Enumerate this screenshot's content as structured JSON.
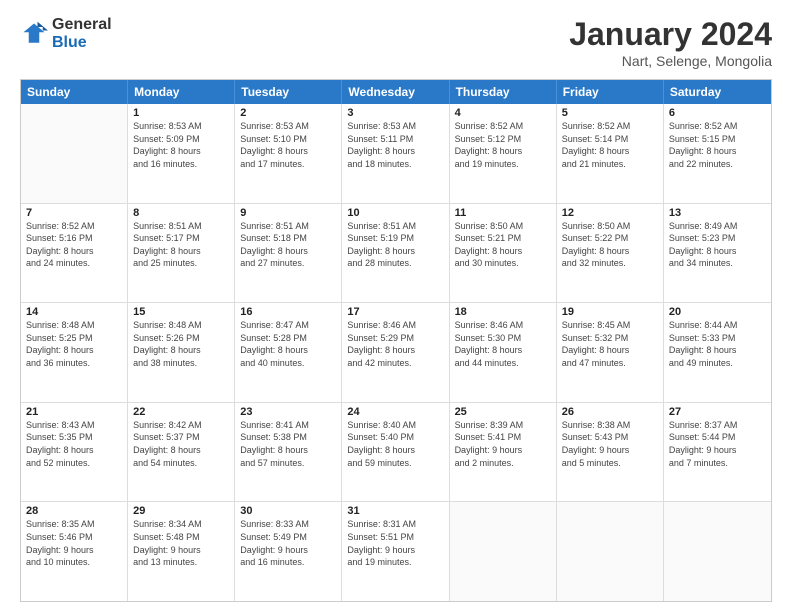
{
  "logo": {
    "general": "General",
    "blue": "Blue"
  },
  "title": "January 2024",
  "subtitle": "Nart, Selenge, Mongolia",
  "header_days": [
    "Sunday",
    "Monday",
    "Tuesday",
    "Wednesday",
    "Thursday",
    "Friday",
    "Saturday"
  ],
  "weeks": [
    [
      {
        "day": "",
        "sunrise": "",
        "sunset": "",
        "daylight": ""
      },
      {
        "day": "1",
        "sunrise": "Sunrise: 8:53 AM",
        "sunset": "Sunset: 5:09 PM",
        "daylight": "Daylight: 8 hours and 16 minutes."
      },
      {
        "day": "2",
        "sunrise": "Sunrise: 8:53 AM",
        "sunset": "Sunset: 5:10 PM",
        "daylight": "Daylight: 8 hours and 17 minutes."
      },
      {
        "day": "3",
        "sunrise": "Sunrise: 8:53 AM",
        "sunset": "Sunset: 5:11 PM",
        "daylight": "Daylight: 8 hours and 18 minutes."
      },
      {
        "day": "4",
        "sunrise": "Sunrise: 8:52 AM",
        "sunset": "Sunset: 5:12 PM",
        "daylight": "Daylight: 8 hours and 19 minutes."
      },
      {
        "day": "5",
        "sunrise": "Sunrise: 8:52 AM",
        "sunset": "Sunset: 5:14 PM",
        "daylight": "Daylight: 8 hours and 21 minutes."
      },
      {
        "day": "6",
        "sunrise": "Sunrise: 8:52 AM",
        "sunset": "Sunset: 5:15 PM",
        "daylight": "Daylight: 8 hours and 22 minutes."
      }
    ],
    [
      {
        "day": "7",
        "sunrise": "Sunrise: 8:52 AM",
        "sunset": "Sunset: 5:16 PM",
        "daylight": "Daylight: 8 hours and 24 minutes."
      },
      {
        "day": "8",
        "sunrise": "Sunrise: 8:51 AM",
        "sunset": "Sunset: 5:17 PM",
        "daylight": "Daylight: 8 hours and 25 minutes."
      },
      {
        "day": "9",
        "sunrise": "Sunrise: 8:51 AM",
        "sunset": "Sunset: 5:18 PM",
        "daylight": "Daylight: 8 hours and 27 minutes."
      },
      {
        "day": "10",
        "sunrise": "Sunrise: 8:51 AM",
        "sunset": "Sunset: 5:19 PM",
        "daylight": "Daylight: 8 hours and 28 minutes."
      },
      {
        "day": "11",
        "sunrise": "Sunrise: 8:50 AM",
        "sunset": "Sunset: 5:21 PM",
        "daylight": "Daylight: 8 hours and 30 minutes."
      },
      {
        "day": "12",
        "sunrise": "Sunrise: 8:50 AM",
        "sunset": "Sunset: 5:22 PM",
        "daylight": "Daylight: 8 hours and 32 minutes."
      },
      {
        "day": "13",
        "sunrise": "Sunrise: 8:49 AM",
        "sunset": "Sunset: 5:23 PM",
        "daylight": "Daylight: 8 hours and 34 minutes."
      }
    ],
    [
      {
        "day": "14",
        "sunrise": "Sunrise: 8:48 AM",
        "sunset": "Sunset: 5:25 PM",
        "daylight": "Daylight: 8 hours and 36 minutes."
      },
      {
        "day": "15",
        "sunrise": "Sunrise: 8:48 AM",
        "sunset": "Sunset: 5:26 PM",
        "daylight": "Daylight: 8 hours and 38 minutes."
      },
      {
        "day": "16",
        "sunrise": "Sunrise: 8:47 AM",
        "sunset": "Sunset: 5:28 PM",
        "daylight": "Daylight: 8 hours and 40 minutes."
      },
      {
        "day": "17",
        "sunrise": "Sunrise: 8:46 AM",
        "sunset": "Sunset: 5:29 PM",
        "daylight": "Daylight: 8 hours and 42 minutes."
      },
      {
        "day": "18",
        "sunrise": "Sunrise: 8:46 AM",
        "sunset": "Sunset: 5:30 PM",
        "daylight": "Daylight: 8 hours and 44 minutes."
      },
      {
        "day": "19",
        "sunrise": "Sunrise: 8:45 AM",
        "sunset": "Sunset: 5:32 PM",
        "daylight": "Daylight: 8 hours and 47 minutes."
      },
      {
        "day": "20",
        "sunrise": "Sunrise: 8:44 AM",
        "sunset": "Sunset: 5:33 PM",
        "daylight": "Daylight: 8 hours and 49 minutes."
      }
    ],
    [
      {
        "day": "21",
        "sunrise": "Sunrise: 8:43 AM",
        "sunset": "Sunset: 5:35 PM",
        "daylight": "Daylight: 8 hours and 52 minutes."
      },
      {
        "day": "22",
        "sunrise": "Sunrise: 8:42 AM",
        "sunset": "Sunset: 5:37 PM",
        "daylight": "Daylight: 8 hours and 54 minutes."
      },
      {
        "day": "23",
        "sunrise": "Sunrise: 8:41 AM",
        "sunset": "Sunset: 5:38 PM",
        "daylight": "Daylight: 8 hours and 57 minutes."
      },
      {
        "day": "24",
        "sunrise": "Sunrise: 8:40 AM",
        "sunset": "Sunset: 5:40 PM",
        "daylight": "Daylight: 8 hours and 59 minutes."
      },
      {
        "day": "25",
        "sunrise": "Sunrise: 8:39 AM",
        "sunset": "Sunset: 5:41 PM",
        "daylight": "Daylight: 9 hours and 2 minutes."
      },
      {
        "day": "26",
        "sunrise": "Sunrise: 8:38 AM",
        "sunset": "Sunset: 5:43 PM",
        "daylight": "Daylight: 9 hours and 5 minutes."
      },
      {
        "day": "27",
        "sunrise": "Sunrise: 8:37 AM",
        "sunset": "Sunset: 5:44 PM",
        "daylight": "Daylight: 9 hours and 7 minutes."
      }
    ],
    [
      {
        "day": "28",
        "sunrise": "Sunrise: 8:35 AM",
        "sunset": "Sunset: 5:46 PM",
        "daylight": "Daylight: 9 hours and 10 minutes."
      },
      {
        "day": "29",
        "sunrise": "Sunrise: 8:34 AM",
        "sunset": "Sunset: 5:48 PM",
        "daylight": "Daylight: 9 hours and 13 minutes."
      },
      {
        "day": "30",
        "sunrise": "Sunrise: 8:33 AM",
        "sunset": "Sunset: 5:49 PM",
        "daylight": "Daylight: 9 hours and 16 minutes."
      },
      {
        "day": "31",
        "sunrise": "Sunrise: 8:31 AM",
        "sunset": "Sunset: 5:51 PM",
        "daylight": "Daylight: 9 hours and 19 minutes."
      },
      {
        "day": "",
        "sunrise": "",
        "sunset": "",
        "daylight": ""
      },
      {
        "day": "",
        "sunrise": "",
        "sunset": "",
        "daylight": ""
      },
      {
        "day": "",
        "sunrise": "",
        "sunset": "",
        "daylight": ""
      }
    ]
  ]
}
